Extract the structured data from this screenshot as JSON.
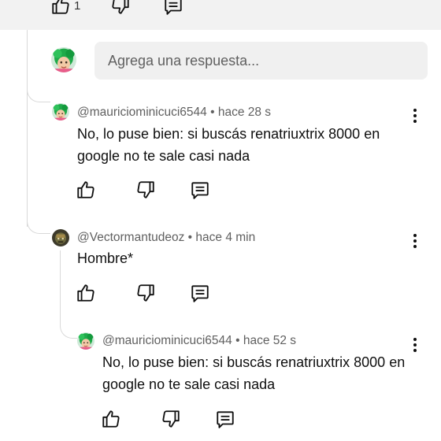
{
  "top_actions": {
    "like_count": "1"
  },
  "reply_box": {
    "placeholder": "Agrega una respuesta..."
  },
  "comments": [
    {
      "author": "@mauriciominicuci6544",
      "separator": " • ",
      "time": "hace 28 s",
      "text": "No, lo puse bien: si buscás renatriuxtrix 8000 en google no te sale casi nada"
    },
    {
      "author": "@Vectormantudeoz",
      "separator": " • ",
      "time": "hace 4 min",
      "text": "Hombre*"
    },
    {
      "author": "@mauriciominicuci6544",
      "separator": " • ",
      "time": "hace 52 s",
      "text": "No, lo puse bien: si buscás renatriuxtrix 8000 en google no te sale casi nada"
    }
  ],
  "icons": {
    "like": "thumb-up-icon",
    "dislike": "thumb-down-icon",
    "reply": "comment-icon",
    "more": "more-vert-icon"
  }
}
